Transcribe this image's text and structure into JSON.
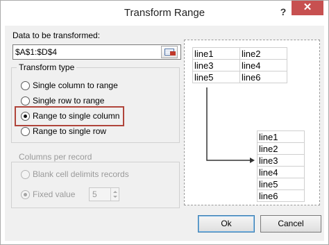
{
  "window": {
    "title": "Transform Range",
    "help_label": "?",
    "close_label": "✕"
  },
  "source": {
    "label": "Data to be transformed:",
    "value": "$A$1:$D$4",
    "picker_icon": "range-select-icon"
  },
  "transform_type": {
    "legend": "Transform type",
    "options": [
      {
        "label": "Single column to range",
        "checked": false
      },
      {
        "label": "Single row to range",
        "checked": false
      },
      {
        "label": "Range to single column",
        "checked": true
      },
      {
        "label": "Range to single row",
        "checked": false
      }
    ],
    "highlight_color": "#b0443a"
  },
  "columns_per_record": {
    "legend": "Columns per record",
    "enabled": false,
    "blank_cell_label": "Blank cell delimits records",
    "fixed_value_label": "Fixed value",
    "fixed_value": "5"
  },
  "preview": {
    "source_cells": [
      [
        "line1",
        "line2"
      ],
      [
        "line3",
        "line4"
      ],
      [
        "line5",
        "line6"
      ]
    ],
    "result_cells": [
      "line1",
      "line2",
      "line3",
      "line4",
      "line5",
      "line6"
    ]
  },
  "buttons": {
    "ok": "Ok",
    "cancel": "Cancel"
  }
}
